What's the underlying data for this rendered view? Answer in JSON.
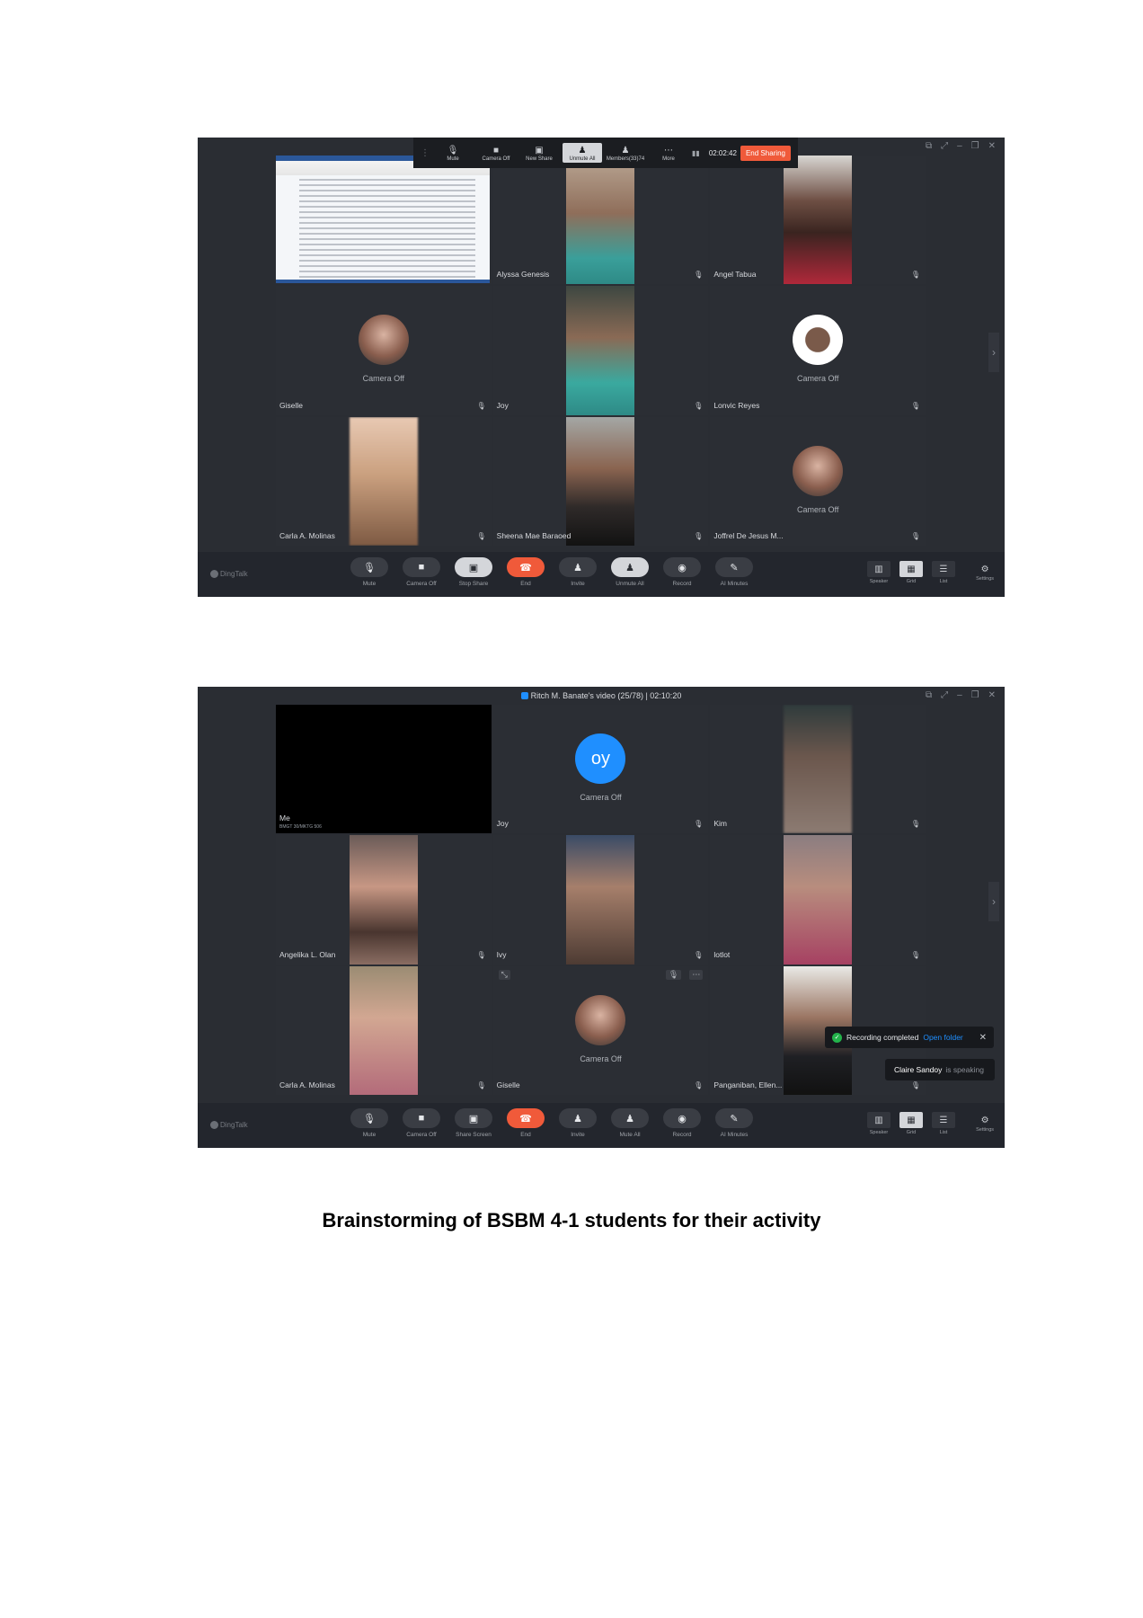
{
  "shot1": {
    "share_bar": {
      "buttons": [
        {
          "label": "Mute",
          "icon": "mic-icon"
        },
        {
          "label": "Camera Off",
          "icon": "camera-icon"
        },
        {
          "label": "New Share",
          "icon": "share-icon"
        },
        {
          "label": "Unmute All",
          "icon": "unmute-all-icon"
        },
        {
          "label": "Members(33)74",
          "icon": "members-icon"
        },
        {
          "label": "More",
          "icon": "more-icon"
        }
      ],
      "timer": "02:02:42",
      "end_sharing": "End Sharing"
    },
    "tiles": [
      {
        "name": ""
      },
      {
        "name": "Alyssa Genesis"
      },
      {
        "name": "Angel Tabua"
      },
      {
        "name": "Giselle",
        "camera_off": "Camera Off"
      },
      {
        "name": "Joy"
      },
      {
        "name": "Lonvic Reyes",
        "camera_off": "Camera Off"
      },
      {
        "name": "Carla A. Molinas"
      },
      {
        "name": "Sheena Mae Baraoed"
      },
      {
        "name": "Joffrel De Jesus M...",
        "camera_off": "Camera Off"
      }
    ],
    "toolbar": {
      "brand": "DingTalk",
      "buttons": [
        "Mute",
        "Camera Off",
        "Stop Share",
        "End",
        "Invite",
        "Unmute All",
        "Record",
        "AI Minutes"
      ],
      "views": [
        "Speaker",
        "Grid",
        "List"
      ],
      "settings": "Settings"
    }
  },
  "shot2": {
    "title": "Ritch M. Banate's video (25/78) | 02:10:20",
    "tiles": [
      {
        "name": "Me",
        "sub": "BMGT 30/MKTG 506"
      },
      {
        "name": "Joy",
        "camera_off": "Camera Off",
        "avatar_text": "oy"
      },
      {
        "name": "Kim"
      },
      {
        "name": "Angelika L. Olan"
      },
      {
        "name": "Ivy"
      },
      {
        "name": "lotlot"
      },
      {
        "name": "Carla A. Molinas"
      },
      {
        "name": "Giselle",
        "camera_off": "Camera Off"
      },
      {
        "name": "Panganiban, Ellen..."
      }
    ],
    "toast": {
      "text": "Recording completed",
      "link": "Open folder"
    },
    "speaking": {
      "name": "Claire Sandoy",
      "status": "is speaking"
    },
    "toolbar": {
      "brand": "DingTalk",
      "buttons": [
        "Mute",
        "Camera Off",
        "Share Screen",
        "End",
        "Invite",
        "Mute All",
        "Record",
        "AI Minutes"
      ],
      "views": [
        "Speaker",
        "Grid",
        "List"
      ],
      "settings": "Settings"
    }
  },
  "caption": "Brainstorming of BSBM 4-1 students for their activity"
}
